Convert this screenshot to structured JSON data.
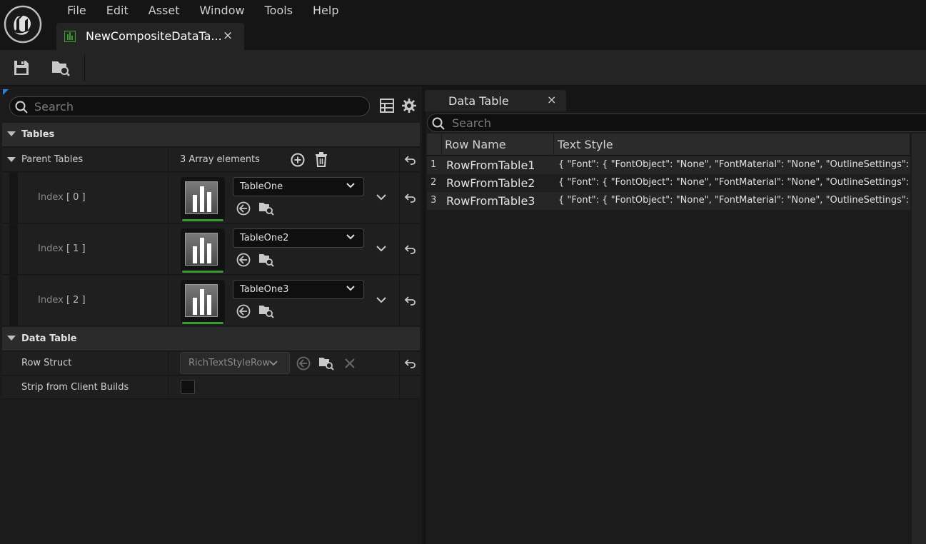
{
  "menu": [
    "File",
    "Edit",
    "Asset",
    "Window",
    "Tools",
    "Help"
  ],
  "document_tab": {
    "title": "NewCompositeDataTa...",
    "close": "×"
  },
  "details": {
    "search_placeholder": "Search",
    "categories": {
      "tables": "Tables",
      "data_table": "Data Table"
    },
    "parent_tables": {
      "label": "Parent Tables",
      "count": "3 Array elements",
      "items": [
        {
          "index_label": "Index",
          "index": "[ 0 ]",
          "value": "TableOne"
        },
        {
          "index_label": "Index",
          "index": "[ 1 ]",
          "value": "TableOne2"
        },
        {
          "index_label": "Index",
          "index": "[ 2 ]",
          "value": "TableOne3"
        }
      ]
    },
    "row_struct": {
      "label": "Row Struct",
      "value": "RichTextStyleRow"
    },
    "strip": {
      "label": "Strip from Client Builds",
      "checked": false
    }
  },
  "data_table": {
    "tab_title": "Data Table",
    "tab_close": "×",
    "search_placeholder": "Search",
    "columns": [
      "Row Name",
      "Text Style"
    ],
    "rows": [
      {
        "num": "1",
        "name": "RowFromTable1",
        "style": "{ \"Font\": { \"FontObject\": \"None\", \"FontMaterial\": \"None\", \"OutlineSettings\": {"
      },
      {
        "num": "2",
        "name": "RowFromTable2",
        "style": "{ \"Font\": { \"FontObject\": \"None\", \"FontMaterial\": \"None\", \"OutlineSettings\": {"
      },
      {
        "num": "3",
        "name": "RowFromTable3",
        "style": "{ \"Font\": { \"FontObject\": \"None\", \"FontMaterial\": \"None\", \"OutlineSettings\": {"
      }
    ]
  },
  "colors": {
    "accent_green": "#3a9b2e",
    "accent_blue": "#2f7fe0"
  }
}
